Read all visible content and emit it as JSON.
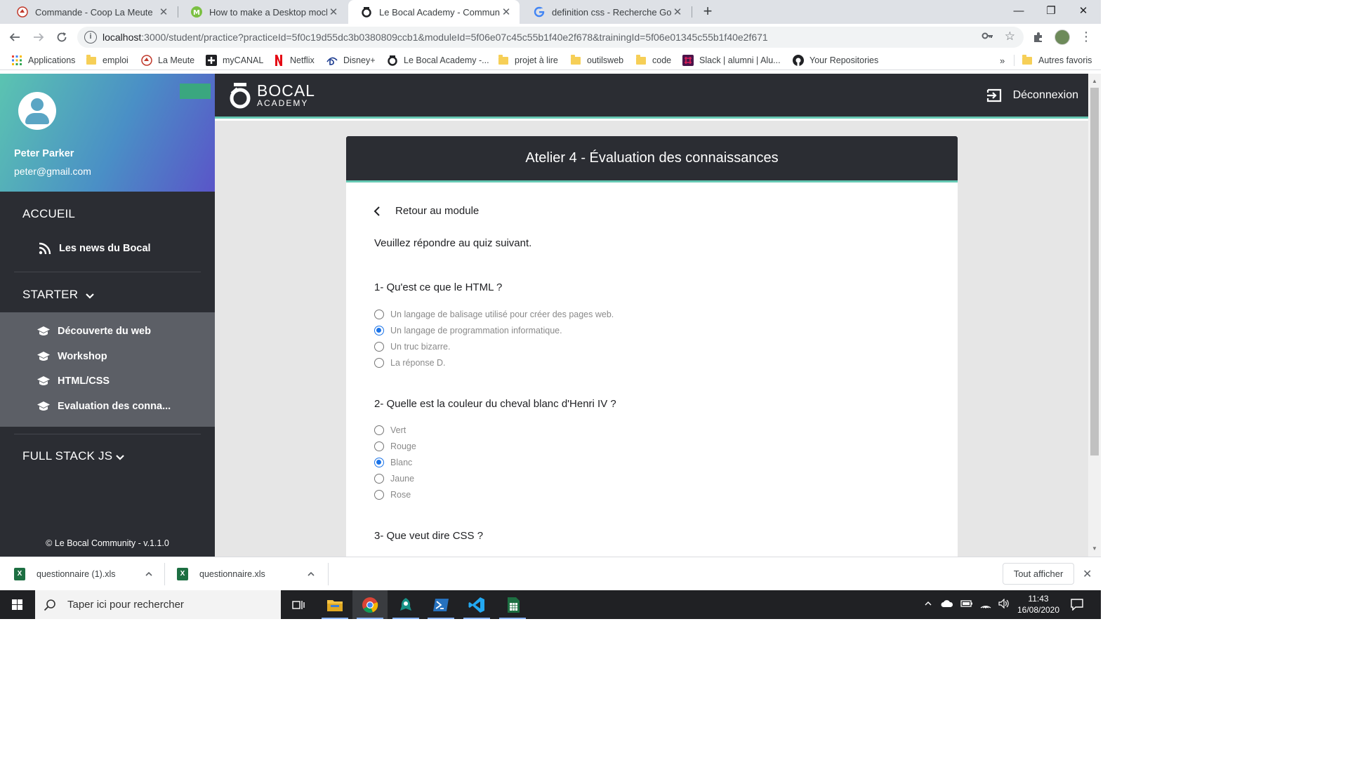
{
  "browser": {
    "tabs": [
      {
        "title": "Commande - Coop La Meute",
        "active": false
      },
      {
        "title": "How to make a Desktop mockup",
        "active": false
      },
      {
        "title": "Le Bocal Academy - Community",
        "active": true
      },
      {
        "title": "definition css - Recherche Google",
        "active": false
      }
    ],
    "new_tab": "+",
    "window_controls": {
      "minimize": "—",
      "restore": "❐",
      "close": "✕"
    },
    "url_host": "localhost",
    "url_rest": ":3000/student/practice?practiceId=5f0c19d55dc3b0380809ccb1&moduleId=5f06e07c45c55b1f40e2f678&trainingId=5f06e01345c55b1f40e2f671",
    "bookmarks": [
      {
        "label": "Applications",
        "icon": "apps-grid-icon"
      },
      {
        "label": "emploi",
        "icon": "folder-icon"
      },
      {
        "label": "La Meute",
        "icon": "lameute-icon"
      },
      {
        "label": "myCANAL",
        "icon": "mycanal-icon"
      },
      {
        "label": "Netflix",
        "icon": "netflix-icon"
      },
      {
        "label": "Disney+",
        "icon": "disney-icon"
      },
      {
        "label": "Le Bocal Academy -...",
        "icon": "bocal-icon"
      },
      {
        "label": "projet à lire",
        "icon": "folder-icon"
      },
      {
        "label": "outilsweb",
        "icon": "folder-icon"
      },
      {
        "label": "code",
        "icon": "folder-icon"
      },
      {
        "label": "Slack | alumni | Alu...",
        "icon": "slack-icon"
      },
      {
        "label": "Your Repositories",
        "icon": "github-icon"
      }
    ],
    "more_bookmarks": "»",
    "other_bookmarks": "Autres favoris"
  },
  "sidebar": {
    "user_name": "Peter Parker",
    "user_email": "peter@gmail.com",
    "home_title": "ACCUEIL",
    "news_label": "Les news du Bocal",
    "starter_title": "STARTER",
    "starter_items": [
      {
        "label": "Découverte du web"
      },
      {
        "label": "Workshop"
      },
      {
        "label": "HTML/CSS"
      },
      {
        "label": "Evaluation des conna..."
      }
    ],
    "fullstack_title": "FULL STACK JS",
    "footer": "© Le Bocal Community - v.1.1.0"
  },
  "header": {
    "logo_line1": "BOCAL",
    "logo_line2": "ACADEMY",
    "logout_label": "Déconnexion"
  },
  "card": {
    "title": "Atelier 4 - Évaluation des connaissances",
    "back_label": "Retour au module",
    "intro": "Veuillez répondre au quiz suivant.",
    "questions": [
      {
        "text": "1- Qu'est ce que le HTML ?",
        "options": [
          {
            "label": "Un langage de balisage utilisé pour créer des pages web.",
            "checked": false
          },
          {
            "label": "Un langage de programmation informatique.",
            "checked": true
          },
          {
            "label": "Un truc bizarre.",
            "checked": false
          },
          {
            "label": "La réponse D.",
            "checked": false
          }
        ]
      },
      {
        "text": "2- Quelle est la couleur du cheval blanc d'Henri IV ?",
        "options": [
          {
            "label": "Vert",
            "checked": false
          },
          {
            "label": "Rouge",
            "checked": false
          },
          {
            "label": "Blanc",
            "checked": true
          },
          {
            "label": "Jaune",
            "checked": false
          },
          {
            "label": "Rose",
            "checked": false
          }
        ]
      },
      {
        "text": "3- Que veut dire CSS ?",
        "options": []
      }
    ]
  },
  "downloads": {
    "items": [
      {
        "name": "questionnaire (1).xls"
      },
      {
        "name": "questionnaire.xls"
      }
    ],
    "show_all": "Tout afficher",
    "close": "✕"
  },
  "taskbar": {
    "search_placeholder": "Taper ici pour rechercher",
    "time": "11:43",
    "date": "16/08/2020",
    "apps": [
      "task-view-icon",
      "file-explorer-icon",
      "chrome-icon",
      "gitkraken-icon",
      "powershell-icon",
      "vscode-icon",
      "excel-icon"
    ]
  },
  "colors": {
    "sidebar_bg": "#2b2d33",
    "accent_teal": "#65c8b3",
    "submenu_bg": "#5c5f66",
    "radio_checked": "#1a73e8"
  }
}
